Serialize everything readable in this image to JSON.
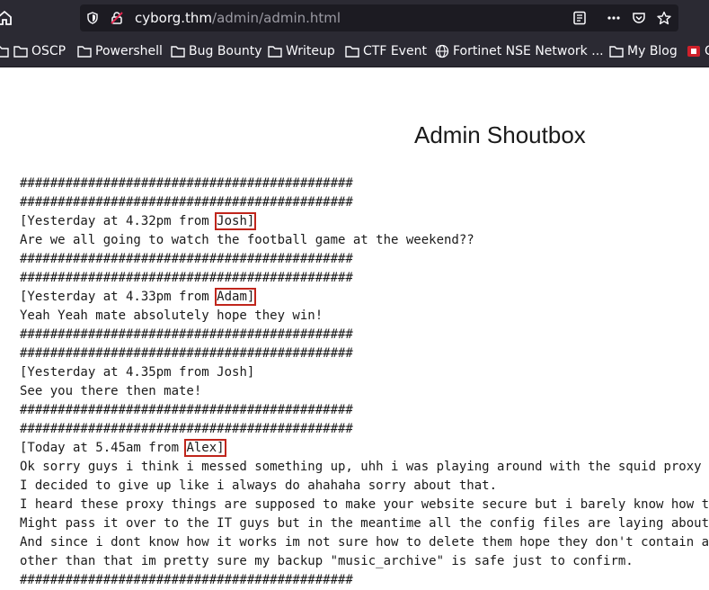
{
  "browser": {
    "url_host": "cyborg.thm",
    "url_path": "/admin/admin.html"
  },
  "bookmarks": [
    {
      "label": "OSCP",
      "icon": "folder-icon"
    },
    {
      "label": "Powershell",
      "icon": "folder-icon"
    },
    {
      "label": "Bug Bounty",
      "icon": "folder-icon"
    },
    {
      "label": "Writeup",
      "icon": "folder-icon"
    },
    {
      "label": "CTF Event",
      "icon": "folder-icon"
    },
    {
      "label": "Fortinet NSE Network ...",
      "icon": "globe-icon"
    },
    {
      "label": "My Blog",
      "icon": "folder-icon"
    },
    {
      "label": "C",
      "icon": "red-site-icon"
    }
  ],
  "page": {
    "title": "Admin Shoutbox",
    "separator": "############################################",
    "messages": [
      {
        "header_prefix": "[Yesterday at 4.32pm from ",
        "sender": "Josh]",
        "body": [
          "Are we all going to watch the football game at the weekend??"
        ]
      },
      {
        "header_prefix": "[Yesterday at 4.33pm from ",
        "sender": "Adam]",
        "body": [
          "Yeah Yeah mate absolutely hope they win!"
        ]
      },
      {
        "header_prefix": "[Yesterday at 4.35pm from ",
        "sender": "Josh]",
        "body": [
          "See you there then mate!"
        ]
      },
      {
        "header_prefix": "[Today at 5.45am from ",
        "sender": "Alex]",
        "body": [
          "Ok sorry guys i think i messed something up, uhh i was playing around with the squid proxy i",
          "I decided to give up like i always do ahahaha sorry about that.",
          "I heard these proxy things are supposed to make your website secure but i barely know how to",
          "Might pass it over to the IT guys but in the meantime all the config files are laying about",
          "And since i dont know how it works im not sure how to delete them hope they don't contain an",
          "other than that im pretty sure my backup \"music_archive\" is safe just to confirm."
        ]
      }
    ]
  }
}
